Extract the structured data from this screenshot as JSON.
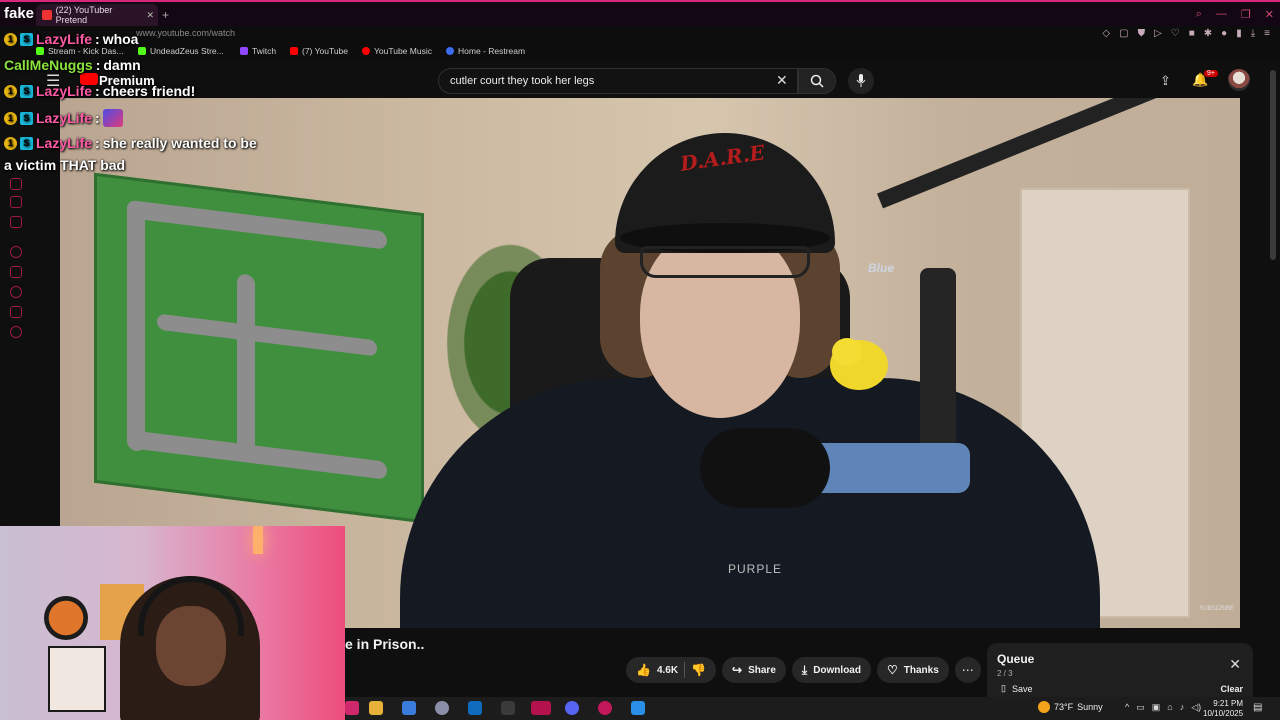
{
  "browser": {
    "tab_title": "(22) YouTuber Pretend",
    "url": "www.youtube.com/watch",
    "bookmarks": [
      "Stream - Kick Das...",
      "UndeadZeus Stre...",
      "Twitch",
      "(7) YouTube",
      "YouTube Music",
      "Home - Restream"
    ]
  },
  "youtube": {
    "logo_text": "Premium",
    "search_query": "cutler court they took her legs",
    "notif_count": "9+",
    "video_title": "e in Prison..",
    "video_overlay": {
      "shirt_text": "PURPLE",
      "cap_text": "D.A.R.E",
      "mic_brand": "Blue",
      "subscribe": "SUBSCRIBE"
    },
    "actions": {
      "likes": "4.6K",
      "share": "Share",
      "download": "Download",
      "thanks": "Thanks"
    },
    "queue": {
      "title": "Queue",
      "count": "2 / 3",
      "save": "Save",
      "clear": "Clear"
    }
  },
  "stream_overlay": {
    "brand": "fake",
    "chat": [
      {
        "user": "LazyLife",
        "color": "#ff5aa6",
        "badges": true,
        "text": "whoa"
      },
      {
        "user": "CallMeNuggs",
        "color": "#8be33b",
        "badges": false,
        "text": "damn"
      },
      {
        "user": "LazyLife",
        "color": "#ff5aa6",
        "badges": true,
        "text": "cheers friend!"
      },
      {
        "user": "LazyLife",
        "color": "#ff5aa6",
        "badges": true,
        "text": ""
      },
      {
        "user": "LazyLife",
        "color": "#ff5aa6",
        "badges": true,
        "text": "she really wanted to be"
      },
      {
        "user": "",
        "color": "#ffffff",
        "badges": false,
        "text": "a victim THAT bad"
      }
    ]
  },
  "taskbar": {
    "temperature": "73°F",
    "weather": "Sunny",
    "time": "9:21 PM",
    "date": "10/10/2025"
  },
  "colors": {
    "accent_pink": "#d6287a",
    "yt_red": "#ff0000",
    "chat_pink": "#ff5aa6",
    "chat_green": "#8be33b"
  }
}
